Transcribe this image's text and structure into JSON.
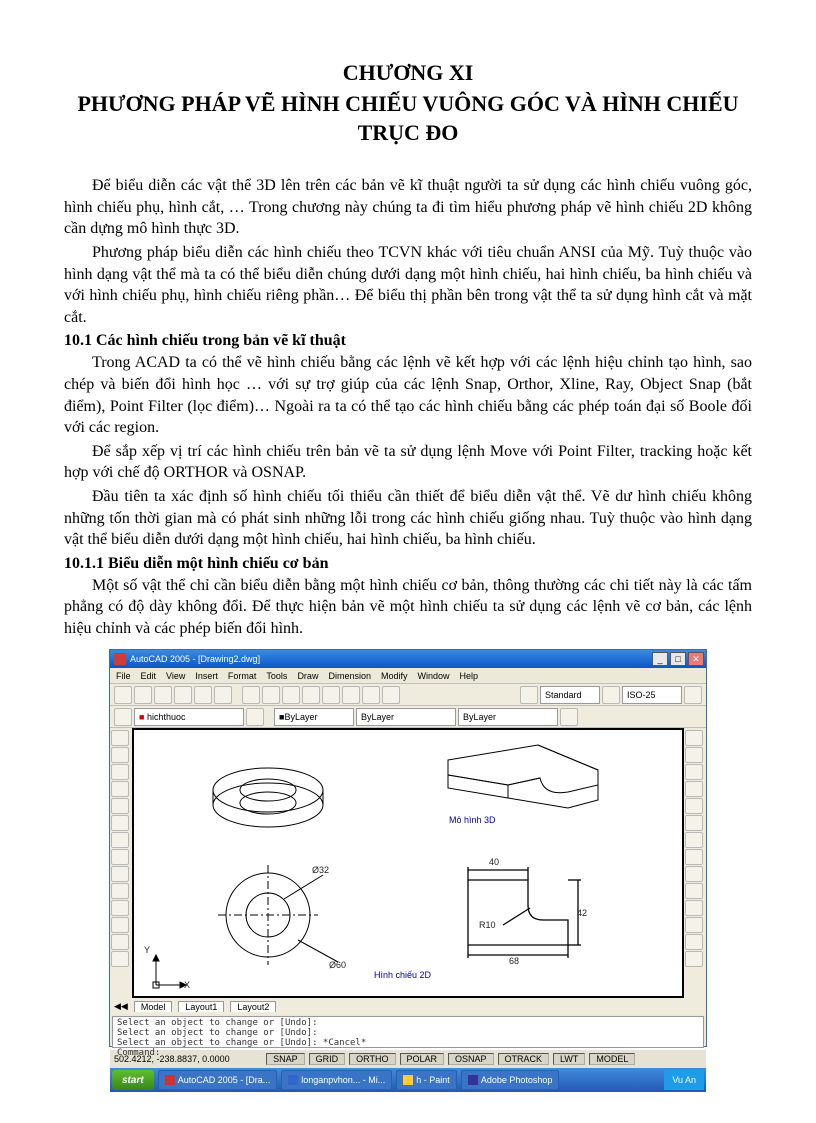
{
  "chapter": {
    "number": "CHƯƠNG XI",
    "title": "PHƯƠNG PHÁP VẼ HÌNH CHIẾU VUÔNG GÓC VÀ HÌNH CHIẾU TRỤC ĐO"
  },
  "p1": "Để biểu diễn các vật thể 3D lên trên các bản vẽ kĩ thuật người ta sử dụng các hình chiếu vuông góc, hình chiếu phụ, hình cắt, … Trong chương này chúng ta đi tìm hiểu phương pháp vẽ hình chiếu 2D không cần dựng mô hình thực 3D.",
  "p2": "Phương pháp biểu diễn các hình chiếu theo TCVN khác với tiêu chuẩn ANSI của Mỹ. Tuỳ thuộc vào hình dạng vật thể mà ta có thể biểu diễn chúng dưới dạng một hình chiếu, hai hình chiếu, ba hình chiếu và với hình chiếu phụ, hình chiếu riêng phần… Để biểu thị phần bên trong vật thể ta sử dụng hình cắt và mặt cắt.",
  "h1": "10.1 Các hình chiếu trong bản vẽ kĩ thuật",
  "p3": "Trong ACAD ta có thể vẽ hình chiếu bằng các lệnh vẽ kết hợp với các lệnh hiệu chỉnh tạo hình, sao chép và biến đổi hình học … với sự trợ giúp của các lệnh Snap, Orthor, Xline, Ray, Object Snap (bắt điểm), Point Filter (lọc điểm)… Ngoài ra ta có thể tạo các hình chiếu bằng các phép toán đại số Boole đối với các region.",
  "p4": "Để sắp xếp vị trí các hình chiếu trên bản vẽ ta sử dụng lệnh Move với Point Filter, tracking hoặc kết hợp với chế độ ORTHOR và OSNAP.",
  "p5": "Đầu tiên ta xác định số hình chiếu tối thiểu cần thiết để biểu diễn vật thể. Vẽ dư hình chiếu không những tốn thời gian mà có phát sinh những lỗi trong các hình chiếu giống nhau. Tuỳ thuộc vào hình dạng vật thể biểu diễn dưới dạng một hình chiếu, hai hình chiếu, ba hình chiếu.",
  "h2": "10.1.1 Biểu diễn một hình chiếu cơ bản",
  "p6": "Một số vật thể chỉ cần biểu diễn bằng một hình chiếu cơ bản, thông thường các chi tiết này là các tấm phẳng có độ dày không đổi. Để thực hiện bản vẽ một hình chiếu ta sử dụng các lệnh vẽ cơ bản, các lệnh hiệu chỉnh và các phép biến đổi hình.",
  "cad": {
    "title": "AutoCAD 2005 - [Drawing2.dwg]",
    "menu": [
      "File",
      "Edit",
      "View",
      "Insert",
      "Format",
      "Tools",
      "Draw",
      "Dimension",
      "Modify",
      "Window",
      "Help"
    ],
    "toolbar2_layer": "hichthuoc",
    "toolbar2_bylayer": "ByLayer",
    "toolbar_style": "Standard",
    "toolbar_dim": "ISO-25",
    "label_3d": "Mô hình 3D",
    "label_2d": "Hình chiếu 2D",
    "dim_40": "40",
    "dim_68": "68",
    "dim_42": "42",
    "dim_r10": "R10",
    "dim_d32": "Ø32",
    "dim_d60": "Ø60",
    "ucs_x": "X",
    "ucs_y": "Y",
    "tabs": [
      "Model",
      "Layout1",
      "Layout2"
    ],
    "cmd1": "Select an object to change or [Undo]:",
    "cmd2": "Select an object to change or [Undo]:",
    "cmd3": "Select an object to change or [Undo]: *Cancel*",
    "cmd_prompt": "Command:",
    "status_coord": "502.4212, -238.8837, 0.0000",
    "status_btns": [
      "SNAP",
      "GRID",
      "ORTHO",
      "POLAR",
      "OSNAP",
      "OTRACK",
      "LWT",
      "MODEL"
    ]
  },
  "taskbar": {
    "start": "start",
    "items": [
      "AutoCAD 2005 - [Dra...",
      "longanpvhon... - Mi...",
      "h - Paint",
      "Adobe Photoshop"
    ],
    "tray": "Vu An"
  }
}
